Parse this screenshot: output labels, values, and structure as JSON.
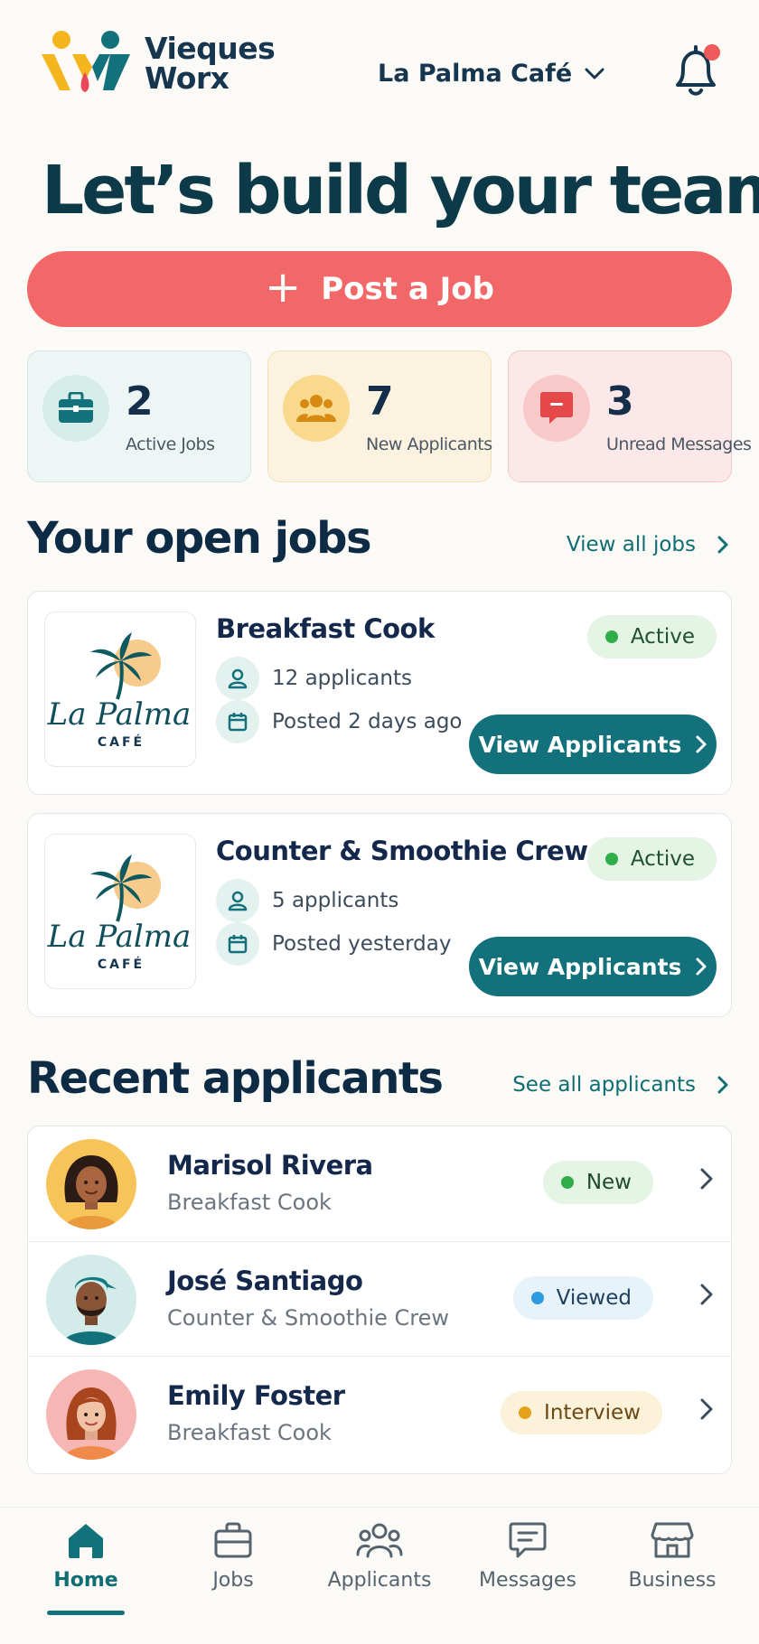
{
  "header": {
    "brand_line1": "Vieques",
    "brand_line2": "Worx",
    "business_name": "La Palma Café"
  },
  "hero_title": "Let’s build your team",
  "post_job_label": "Post a Job",
  "stats": [
    {
      "value": "2",
      "label": "Active Jobs"
    },
    {
      "value": "7",
      "label": "New Applicants"
    },
    {
      "value": "3",
      "label": "Unread Messages"
    }
  ],
  "open_jobs": {
    "title": "Your open jobs",
    "link": "View all jobs",
    "jobs": [
      {
        "title": "Breakfast Cook",
        "applicants": "12 applicants",
        "posted": "Posted 2 days ago",
        "status": "Active",
        "button": "View Applicants",
        "logo_script": "La Palma",
        "logo_sub": "CAFÉ"
      },
      {
        "title": "Counter & Smoothie Crew",
        "applicants": "5 applicants",
        "posted": "Posted yesterday",
        "status": "Active",
        "button": "View Applicants",
        "logo_script": "La Palma",
        "logo_sub": "CAFÉ"
      }
    ]
  },
  "recent_applicants": {
    "title": "Recent applicants",
    "link": "See all applicants",
    "items": [
      {
        "name": "Marisol Rivera",
        "role": "Breakfast Cook",
        "status": "New"
      },
      {
        "name": "José Santiago",
        "role": "Counter & Smoothie Crew",
        "status": "Viewed"
      },
      {
        "name": "Emily Foster",
        "role": "Breakfast Cook",
        "status": "Interview"
      }
    ]
  },
  "nav": {
    "items": [
      {
        "label": "Home",
        "icon": "home-icon"
      },
      {
        "label": "Jobs",
        "icon": "briefcase-icon"
      },
      {
        "label": "Applicants",
        "icon": "people-icon"
      },
      {
        "label": "Messages",
        "icon": "chat-icon"
      },
      {
        "label": "Business",
        "icon": "storefront-icon"
      }
    ],
    "active": "Home"
  },
  "colors": {
    "brand_teal": "#12717A",
    "post_button": "#F26868",
    "active_green": "#2EAD48",
    "viewed_blue": "#2C9BE0",
    "interview_amber": "#E5A01C",
    "notification_dot": "#F05A5A"
  }
}
